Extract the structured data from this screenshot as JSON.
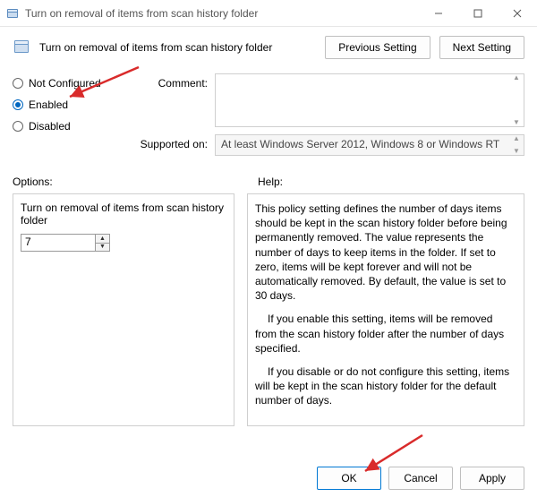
{
  "window": {
    "title": "Turn on removal of items from scan history folder"
  },
  "header": {
    "title": "Turn on removal of items from scan history folder",
    "prev": "Previous Setting",
    "next": "Next Setting"
  },
  "radios": {
    "not_configured": "Not Configured",
    "enabled": "Enabled",
    "disabled": "Disabled",
    "selected": "enabled"
  },
  "fields": {
    "comment_label": "Comment:",
    "comment_value": "",
    "supported_label": "Supported on:",
    "supported_value": "At least Windows Server 2012, Windows 8 or Windows RT"
  },
  "labels": {
    "options": "Options:",
    "help": "Help:"
  },
  "options": {
    "title": "Turn on removal of items from scan history folder",
    "value": "7"
  },
  "help": {
    "p1": "This policy setting defines the number of days items should be kept in the scan history folder before being permanently removed. The value represents the number of days to keep items in the folder. If set to zero, items will be kept forever and will not be automatically removed. By default, the value is set to 30 days.",
    "p2": "If you enable this setting, items will be removed from the scan history folder after the number of days specified.",
    "p3": "If you disable or do not configure this setting, items will be kept in the scan history folder for the default number of days."
  },
  "footer": {
    "ok": "OK",
    "cancel": "Cancel",
    "apply": "Apply"
  }
}
